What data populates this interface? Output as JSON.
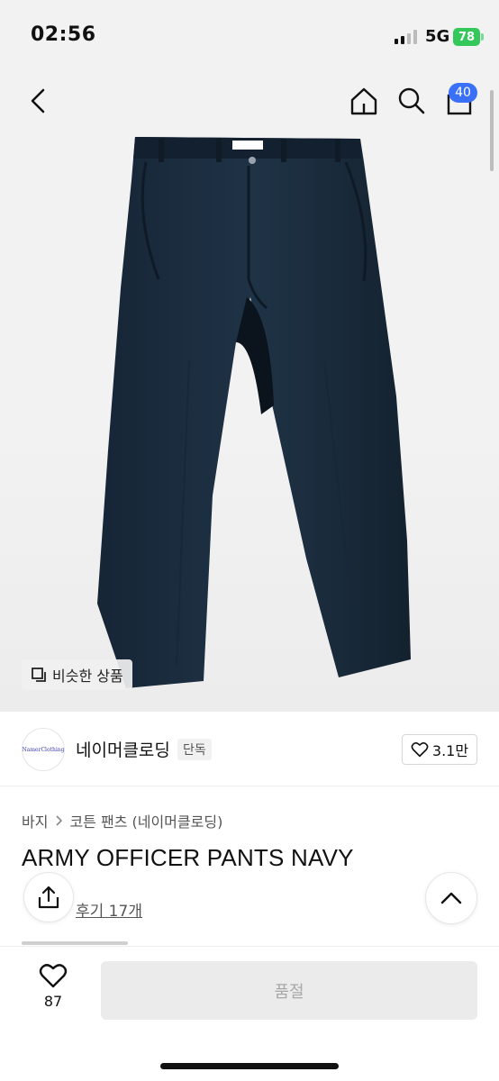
{
  "status_bar": {
    "time": "02:56",
    "network": "5G",
    "battery": "78"
  },
  "nav": {
    "cart_count": "40"
  },
  "hero": {
    "similar_label": "비슷한 상품",
    "logo_text": "NamerClothing"
  },
  "brand": {
    "logo_text": "NamerClothing",
    "name": "네이머클로딩",
    "badge": "단독",
    "likes": "3.1만"
  },
  "breadcrumb": {
    "category": "바지",
    "subcategory": "코튼 팬츠 (네이머클로딩)"
  },
  "product": {
    "title": "ARMY OFFICER PANTS NAVY",
    "review_label": "후기 17개"
  },
  "bottom": {
    "wish_count": "87",
    "buy_label": "품절"
  },
  "colors": {
    "accent": "#3a6ff7",
    "battery": "#34c759",
    "pants": "#1b2c3d"
  },
  "icons": [
    "back-icon",
    "home-icon",
    "search-icon",
    "cart-icon",
    "similar-icon",
    "heart-icon",
    "share-icon",
    "chevron-up-icon"
  ]
}
